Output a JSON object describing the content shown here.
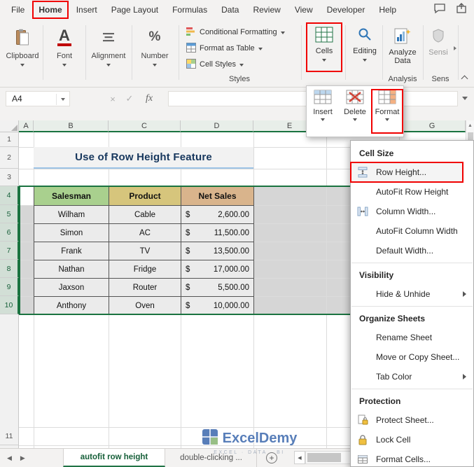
{
  "colors": {
    "excel_green": "#217346",
    "selection_green": "#1a7340",
    "highlight_red": "#f00000",
    "header_salesman": "#a9d08e",
    "header_product": "#d6c57c",
    "header_net_sales": "#d9b48c",
    "selection_gray": "#d6d6d6",
    "title_underline": "#9dc3e6",
    "title_text": "#17375d",
    "watermark_blue": "#2f5fa8"
  },
  "tabbar": {
    "tabs": [
      "File",
      "Home",
      "Insert",
      "Page Layout",
      "Formulas",
      "Data",
      "Review",
      "View",
      "Developer",
      "Help"
    ],
    "active_tab": "Home"
  },
  "ribbon": {
    "groups": {
      "clipboard": "Clipboard",
      "font": "Font",
      "alignment": "Alignment",
      "number": "Number",
      "styles": "Styles",
      "analysis": "Analysis",
      "sensitivity": "Sens"
    },
    "buttons": {
      "font_symbol": "A",
      "number_symbol": "%",
      "conditional_formatting": "Conditional Formatting",
      "format_as_table": "Format as Table",
      "cell_styles": "Cell Styles",
      "cells": "Cells",
      "editing": "Editing",
      "analyze_line1": "Analyze",
      "analyze_line2": "Data",
      "sensitivity": "Sensi"
    }
  },
  "formula_bar": {
    "name_box": "A4",
    "cancel": "×",
    "enter": "✓",
    "fx": "fx",
    "formula": ""
  },
  "grid": {
    "columns": [
      "A",
      "B",
      "C",
      "D",
      "E",
      "F",
      "G"
    ],
    "rows": [
      "1",
      "2",
      "3",
      "4",
      "5",
      "6",
      "7",
      "8",
      "9",
      "10",
      "11"
    ],
    "title": "Use of Row Height Feature",
    "table": {
      "headers": [
        "Salesman",
        "Product",
        "Net Sales"
      ],
      "currency": "$",
      "rows": [
        {
          "salesman": "Wilham",
          "product": "Cable",
          "amount": "2,600.00"
        },
        {
          "salesman": "Simon",
          "product": "AC",
          "amount": "11,500.00"
        },
        {
          "salesman": "Frank",
          "product": "TV",
          "amount": "13,500.00"
        },
        {
          "salesman": "Nathan",
          "product": "Fridge",
          "amount": "17,000.00"
        },
        {
          "salesman": "Jaxson",
          "product": "Router",
          "amount": "5,500.00"
        },
        {
          "salesman": "Anthony",
          "product": "Oven",
          "amount": "10,000.00"
        }
      ]
    }
  },
  "cells_menu": {
    "insert": "Insert",
    "delete": "Delete",
    "format": "Format"
  },
  "format_menu": {
    "cell_size_header": "Cell Size",
    "row_height": "Row Height...",
    "autofit_row_height": "AutoFit Row Height",
    "column_width": "Column Width...",
    "autofit_column_width": "AutoFit Column Width",
    "default_width": "Default Width...",
    "visibility_header": "Visibility",
    "hide_unhide": "Hide & Unhide",
    "organize_header": "Organize Sheets",
    "rename_sheet": "Rename Sheet",
    "move_copy": "Move or Copy Sheet...",
    "tab_color": "Tab Color",
    "protection_header": "Protection",
    "protect_sheet": "Protect Sheet...",
    "lock_cell": "Lock Cell",
    "format_cells": "Format Cells..."
  },
  "sheetbar": {
    "tab1": "autofit row height",
    "tab2": "double-clicking ..."
  },
  "watermark": {
    "brand": "ExcelDemy",
    "tagline": "EXCEL · DATA · BI"
  }
}
